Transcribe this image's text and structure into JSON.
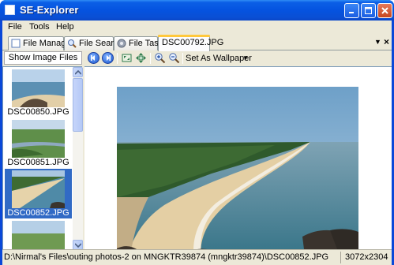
{
  "window": {
    "title": "SE-Explorer"
  },
  "menu": {
    "items": [
      "File",
      "Tools",
      "Help"
    ]
  },
  "tabs": [
    {
      "label": "File Manager",
      "icon": "file-manager-icon"
    },
    {
      "label": "File Search",
      "icon": "search-icon"
    },
    {
      "label": "File Tasks",
      "icon": "gear-icon"
    },
    {
      "label": "DSC00792.JPG",
      "active": true
    }
  ],
  "toolbar": {
    "show_images_label": "Show Image Files",
    "wallpaper_label": "Set As Wallpaper"
  },
  "thumbnails": [
    {
      "name": "DSC00850.JPG"
    },
    {
      "name": "DSC00851.JPG"
    },
    {
      "name": "DSC00852.JPG",
      "selected": true
    },
    {
      "name": ""
    }
  ],
  "status": {
    "path": "D:\\Nirmal's Files\\outing photos-2 on MNGKTR39874 (mngktr39874)\\DSC00852.JPG",
    "dimensions": "3072x2304"
  },
  "colors": {
    "titlebar": "#0553e0",
    "selection": "#316ac5",
    "tab_accent": "#ffc83c"
  }
}
